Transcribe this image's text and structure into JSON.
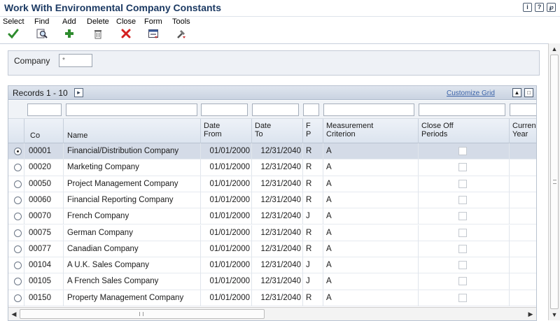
{
  "window": {
    "title": "Work With Environmental Company Constants",
    "icons": [
      "info-icon",
      "help-icon",
      "about-icon"
    ]
  },
  "toolbar": {
    "select": "Select",
    "find": "Find",
    "add": "Add",
    "delete": "Delete",
    "close": "Close",
    "form": "Form",
    "tools": "Tools"
  },
  "header_form": {
    "company_label": "Company",
    "company_value": "*"
  },
  "grid": {
    "records_label": "Records 1 - 10",
    "customize_label": "Customize Grid",
    "columns": {
      "co": "Co",
      "name": "Name",
      "date_from": "Date\nFrom",
      "date_to": "Date\nTo",
      "fp": "F\nP",
      "measurement": "Measurement\nCriterion",
      "close_off": "Close Off\nPeriods",
      "current_year": "Curren\nYear"
    },
    "rows": [
      {
        "co": "00001",
        "name": "Financial/Distribution Company",
        "date_from": "01/01/2000",
        "date_to": "12/31/2040",
        "fp": "R",
        "measurement": "A",
        "selected": true
      },
      {
        "co": "00020",
        "name": "Marketing Company",
        "date_from": "01/01/2000",
        "date_to": "12/31/2040",
        "fp": "R",
        "measurement": "A",
        "selected": false
      },
      {
        "co": "00050",
        "name": "Project Management Company",
        "date_from": "01/01/2000",
        "date_to": "12/31/2040",
        "fp": "R",
        "measurement": "A",
        "selected": false
      },
      {
        "co": "00060",
        "name": "Financial Reporting Company",
        "date_from": "01/01/2000",
        "date_to": "12/31/2040",
        "fp": "R",
        "measurement": "A",
        "selected": false
      },
      {
        "co": "00070",
        "name": "French Company",
        "date_from": "01/01/2000",
        "date_to": "12/31/2040",
        "fp": "J",
        "measurement": "A",
        "selected": false
      },
      {
        "co": "00075",
        "name": "German Company",
        "date_from": "01/01/2000",
        "date_to": "12/31/2040",
        "fp": "R",
        "measurement": "A",
        "selected": false
      },
      {
        "co": "00077",
        "name": "Canadian Company",
        "date_from": "01/01/2000",
        "date_to": "12/31/2040",
        "fp": "R",
        "measurement": "A",
        "selected": false
      },
      {
        "co": "00104",
        "name": "A U.K. Sales Company",
        "date_from": "01/01/2000",
        "date_to": "12/31/2040",
        "fp": "J",
        "measurement": "A",
        "selected": false
      },
      {
        "co": "00105",
        "name": "A French Sales Company",
        "date_from": "01/01/2000",
        "date_to": "12/31/2040",
        "fp": "J",
        "measurement": "A",
        "selected": false
      },
      {
        "co": "00150",
        "name": "Property Management Company",
        "date_from": "01/01/2000",
        "date_to": "12/31/2040",
        "fp": "R",
        "measurement": "A",
        "selected": false
      }
    ]
  },
  "colors": {
    "title": "#1c3a63",
    "check_green": "#2e8b2e",
    "close_red": "#d42020",
    "link": "#3a62a8",
    "selected_row": "#d4dbe7"
  }
}
